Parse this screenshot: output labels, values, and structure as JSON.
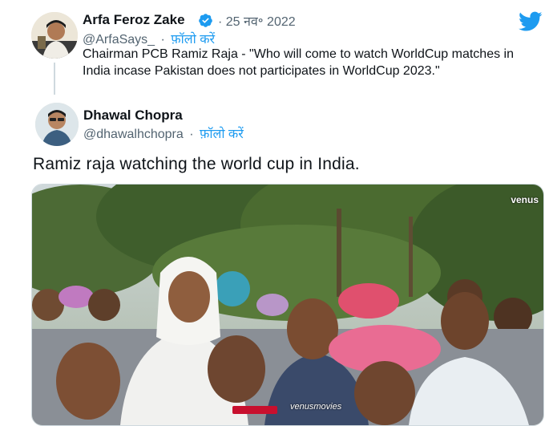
{
  "quoted_tweet": {
    "display_name": "Arfa Feroz Zake",
    "handle": "@ArfaSays_",
    "separator": "·",
    "date": "25 नव॰ 2022",
    "follow_label": "फ़ॉलो करें",
    "text": "Chairman PCB Ramiz Raja - \"Who will come to watch WorldCup matches in India incase Pakistan does not participates in WorldCup 2023.\""
  },
  "reply_tweet": {
    "display_name": "Dhawal Chopra",
    "handle": "@dhawalhchopra",
    "separator": "·",
    "follow_label": "फ़ॉलो करें",
    "text": "Ramiz raja watching the world cup in India."
  },
  "media": {
    "watermark": "venus",
    "bottom_tag": "venusmovies"
  },
  "icons": {
    "brand": "twitter-bird-icon",
    "verified": "verified-badge-icon"
  },
  "colors": {
    "accent": "#1d9bf0",
    "text": "#0f1419",
    "muted": "#536471"
  }
}
